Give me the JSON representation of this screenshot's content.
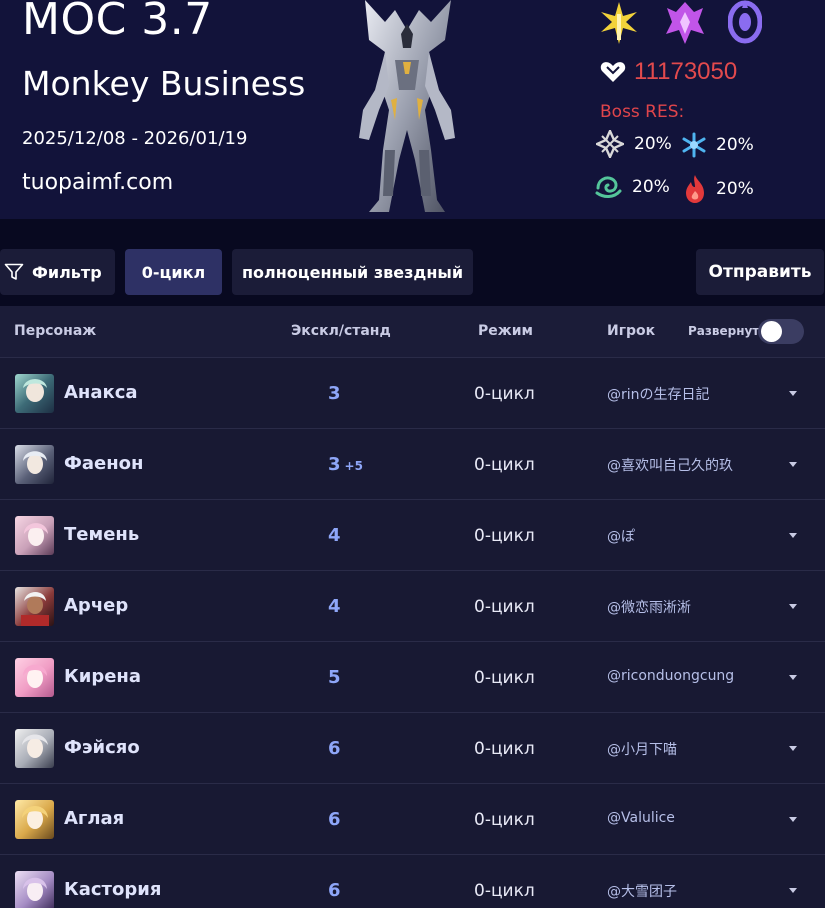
{
  "header": {
    "title": "MOC 3.7",
    "subtitle": "Monkey Business",
    "dates": "2025/12/08 - 2026/01/19",
    "site": "tuopaimf.com",
    "hp": "11173050",
    "res_label": "Boss RES:",
    "resistances": [
      {
        "element": "physical",
        "icon": "physical-element-icon",
        "value": "20%",
        "color": "#d8d8d8"
      },
      {
        "element": "ice",
        "icon": "ice-element-icon",
        "value": "20%",
        "color": "#4fb4f0"
      },
      {
        "element": "wind",
        "icon": "wind-element-icon",
        "value": "20%",
        "color": "#54c59a"
      },
      {
        "element": "fire",
        "icon": "fire-element-icon",
        "value": "20%",
        "color": "#e2393b"
      }
    ],
    "path_icons": [
      {
        "name": "preservation-path-icon",
        "color": "#f2d23a"
      },
      {
        "name": "destruction-path-icon",
        "color": "#c155e8"
      },
      {
        "name": "nihility-path-icon",
        "color": "#8a6cf0"
      }
    ]
  },
  "toolbar": {
    "filter_label": "Фильтр",
    "cycle_label": "0-цикл",
    "star_label": "полноценный звездный",
    "submit_label": "Отправить"
  },
  "table": {
    "columns": {
      "character": "Персонаж",
      "eidolon": "Экскл/станд",
      "mode": "Режим",
      "player": "Игрок",
      "expand": "Развернуть"
    },
    "rows": [
      {
        "name": "Анакса",
        "eidolon": "3",
        "eidolon_extra": "",
        "mode": "0-цикл",
        "player": "@rinの生存日記"
      },
      {
        "name": "Фаенон",
        "eidolon": "3",
        "eidolon_extra": "+5",
        "mode": "0-цикл",
        "player": "@喜欢叫自己久的玖"
      },
      {
        "name": "Темень",
        "eidolon": "4",
        "eidolon_extra": "",
        "mode": "0-цикл",
        "player": "@ぽ"
      },
      {
        "name": "Арчер",
        "eidolon": "4",
        "eidolon_extra": "",
        "mode": "0-цикл",
        "player": "@微恋雨淅淅"
      },
      {
        "name": "Кирена",
        "eidolon": "5",
        "eidolon_extra": "",
        "mode": "0-цикл",
        "player": "@riconduongcung"
      },
      {
        "name": "Фэйсяо",
        "eidolon": "6",
        "eidolon_extra": "",
        "mode": "0-цикл",
        "player": "@小月下喵"
      },
      {
        "name": "Аглая",
        "eidolon": "6",
        "eidolon_extra": "",
        "mode": "0-цикл",
        "player": "@Valulice"
      },
      {
        "name": "Кастория",
        "eidolon": "6",
        "eidolon_extra": "",
        "mode": "0-цикл",
        "player": "@大雪团子"
      }
    ]
  }
}
